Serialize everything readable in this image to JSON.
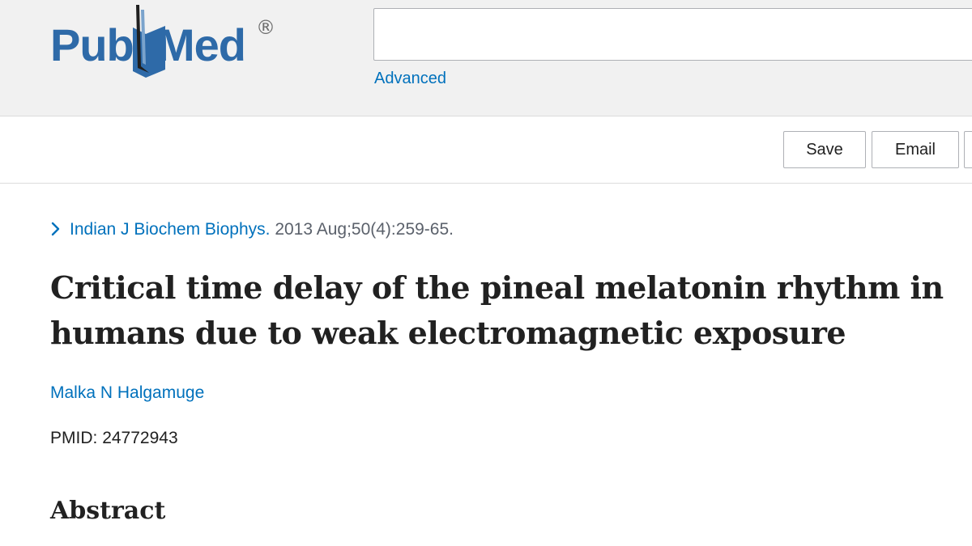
{
  "header": {
    "logo": {
      "part1": "Pub",
      "part2": "Med",
      "registered": "®"
    },
    "search": {
      "value": "",
      "placeholder": ""
    },
    "advanced_label": "Advanced"
  },
  "actions": {
    "save_label": "Save",
    "email_label": "Email",
    "more_label": ""
  },
  "article": {
    "journal": "Indian J Biochem Biophys.",
    "citation_detail": "2013 Aug;50(4):259-65.",
    "title": "Critical time delay of the pineal melatonin rhythm in humans due to weak electromagnetic exposure",
    "author": "Malka N Halgamuge",
    "pmid_label": "PMID:",
    "pmid_value": "24772943",
    "abstract_heading": "Abstract"
  },
  "colors": {
    "brand_blue": "#2e6aa8",
    "link_blue": "#0071bc",
    "header_bg": "#f1f1f1"
  },
  "icons": {
    "logo_book": "open-book-icon",
    "citation_toggle": "chevron-right-icon"
  }
}
